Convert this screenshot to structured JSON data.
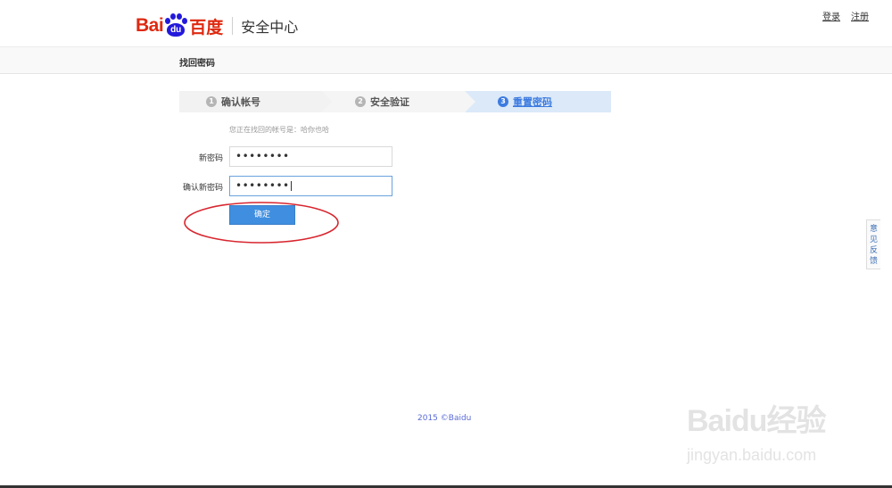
{
  "header": {
    "logo_bai": "Bai",
    "logo_du": "du",
    "logo_cn": "百度",
    "title": "安全中心",
    "login": "登录",
    "register": "注册"
  },
  "subbar": {
    "title": "找回密码"
  },
  "steps": [
    {
      "num": "1",
      "label": "确认帐号",
      "active": false
    },
    {
      "num": "2",
      "label": "安全验证",
      "active": false
    },
    {
      "num": "3",
      "label": "重置密码",
      "active": true
    }
  ],
  "form": {
    "account_line": "您正在找回的帐号是：哈你也哈",
    "new_password_label": "新密码",
    "new_password_value": "••••••••",
    "confirm_password_label": "确认新密码",
    "confirm_password_value": "••••••••",
    "submit_label": "确定"
  },
  "feedback": {
    "label": "意见反馈"
  },
  "footer": {
    "copyright": "2015 ©Baidu"
  },
  "watermark": {
    "logo": "Baidu经验",
    "url": "jingyan.baidu.com"
  },
  "colors": {
    "brand_red": "#de2910",
    "brand_blue": "#2319dc",
    "accent": "#3d7be0",
    "annotation": "#d8262f"
  }
}
